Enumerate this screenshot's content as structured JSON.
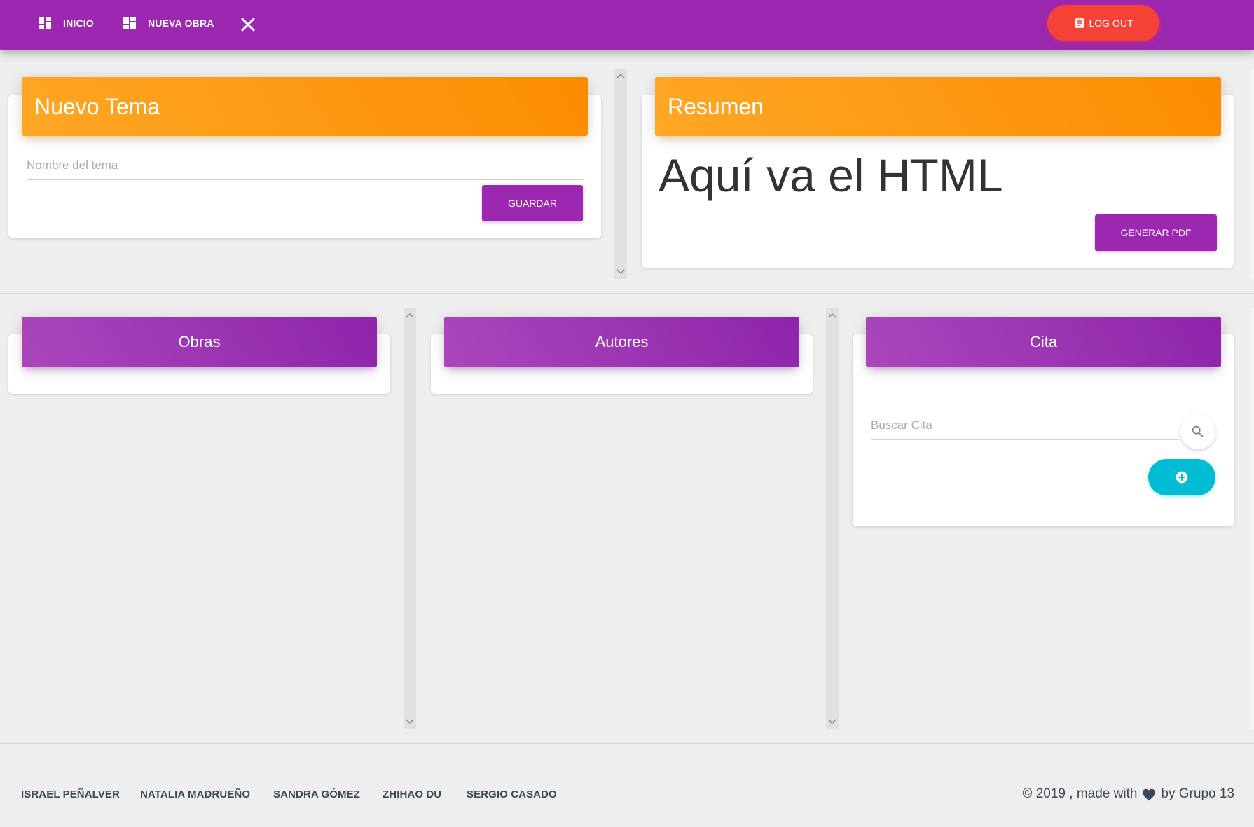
{
  "navbar": {
    "items": [
      {
        "label": "INICIO",
        "icon": "dashboard-icon"
      },
      {
        "label": "NUEVA OBRA",
        "icon": "dashboard-icon"
      }
    ],
    "close_icon": "close-icon",
    "logout_label": "LOG OUT",
    "logout_icon": "clipboard-icon",
    "color": "#9c27b0",
    "logout_color": "#f44336"
  },
  "nuevo_tema": {
    "title": "Nuevo Tema",
    "input_placeholder": "Nombre del tema",
    "save_label": "GUARDAR"
  },
  "resumen": {
    "title": "Resumen",
    "content": "Aquí va el HTML",
    "pdf_label": "GENERAR PDF"
  },
  "obras": {
    "title": "Obras"
  },
  "autores": {
    "title": "Autores"
  },
  "cita": {
    "title": "Cita",
    "search_placeholder": "Buscar Cita",
    "search_icon": "search-icon",
    "add_icon": "add-circle-icon",
    "add_color": "#00bcd4"
  },
  "footer": {
    "links": [
      "ISRAEL PEÑALVER",
      "NATALIA MADRUEÑO",
      "SANDRA GÓMEZ",
      "ZHIHAO DU",
      "SERGIO CASADO"
    ],
    "copyright_prefix": "© 2019 , made with",
    "copyright_suffix": "by Grupo 13",
    "heart_icon": "heart-icon"
  },
  "colors": {
    "header_orange": "#fb8c00",
    "header_purple": "#9c27b0",
    "background": "#eeeeee"
  }
}
